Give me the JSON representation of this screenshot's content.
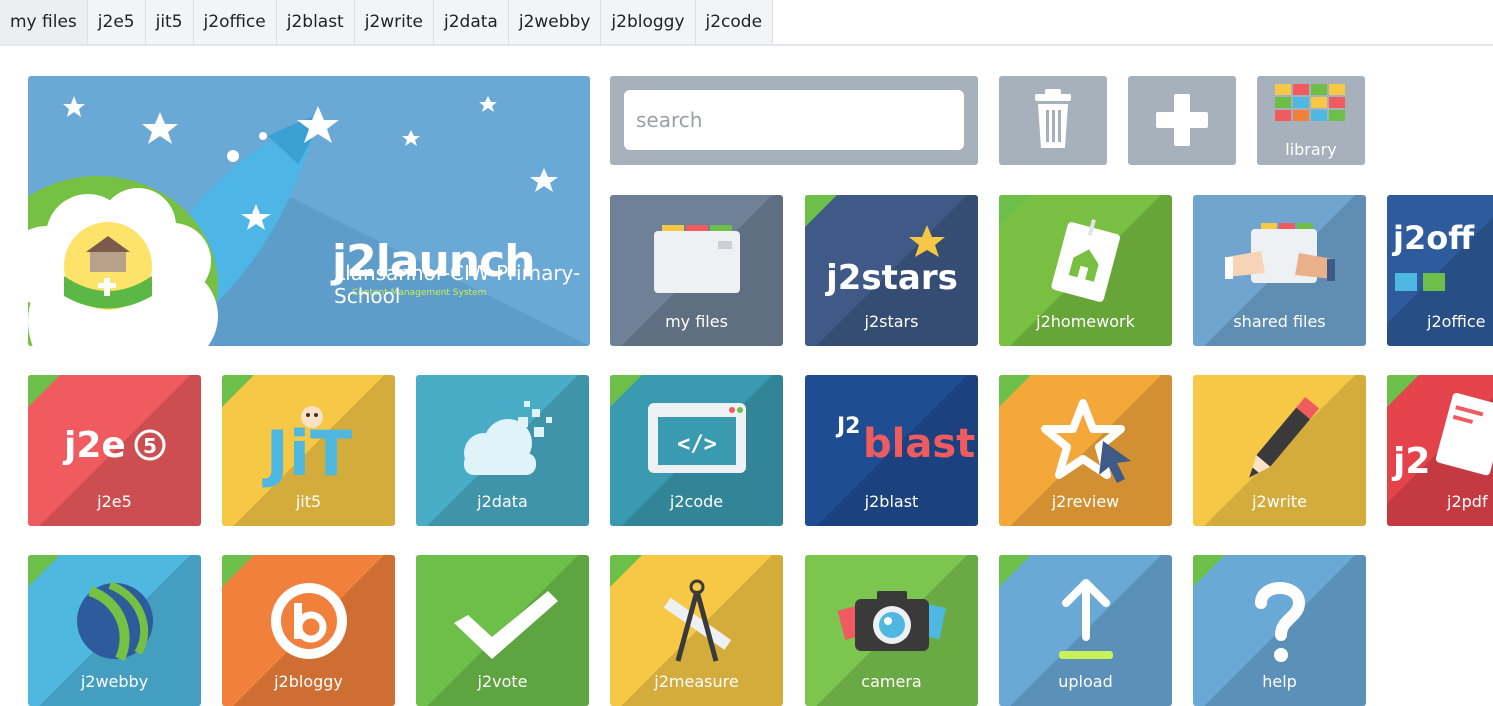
{
  "nav": {
    "items": [
      "my files",
      "j2e5",
      "jit5",
      "j2office",
      "j2blast",
      "j2write",
      "j2data",
      "j2webby",
      "j2bloggy",
      "j2code"
    ]
  },
  "hero": {
    "brand": "j2launch",
    "brand_sub": "Content Management System",
    "school_name": "Llansannor-CIW-Primary-School"
  },
  "search": {
    "placeholder": "search"
  },
  "buttons": {
    "library_label": "library"
  },
  "tiles": {
    "my_files": "my files",
    "j2stars": "j2stars",
    "j2homework": "j2homework",
    "shared_files": "shared files",
    "j2office": "j2office",
    "j2e5": "j2e5",
    "jit5": "jit5",
    "j2data": "j2data",
    "j2code": "j2code",
    "j2blast": "j2blast",
    "j2review": "j2review",
    "j2write": "j2write",
    "j2pdf": "j2pdf",
    "j2webby": "j2webby",
    "j2bloggy": "j2bloggy",
    "j2vote": "j2vote",
    "j2measure": "j2measure",
    "camera": "camera",
    "upload": "upload",
    "help": "help"
  },
  "icon_text": {
    "j2stars": "j2stars",
    "j2e5": "j2e",
    "j2e5_num": "5",
    "jit": "JiT",
    "j2blast": "blast",
    "j2office": "j2off",
    "j2pdf": "j2",
    "code": "</>"
  },
  "colors": {
    "hero": "#6aa8d6",
    "grey": "#a7b1bb",
    "my_files": "#6f8196",
    "j2stars": "#3f5a86",
    "j2homework": "#79c042",
    "shared_files": "#6fa5cf",
    "j2office": "#2d5b9b",
    "j2e5": "#ef5b5e",
    "jit5": "#f7c845",
    "j2data": "#49acc6",
    "j2code": "#3a9ab0",
    "j2blast": "#1f4d93",
    "j2review": "#f5a83a",
    "j2write": "#f7c845",
    "j2pdf": "#e4434b",
    "j2webby": "#4fb8e0",
    "j2bloggy": "#f0803b",
    "j2vote": "#6dbf4a",
    "j2measure": "#f7c845",
    "camera": "#7cc64f",
    "upload": "#6aa8d6",
    "help": "#6aa8d6",
    "corner": "#6cc04a"
  }
}
